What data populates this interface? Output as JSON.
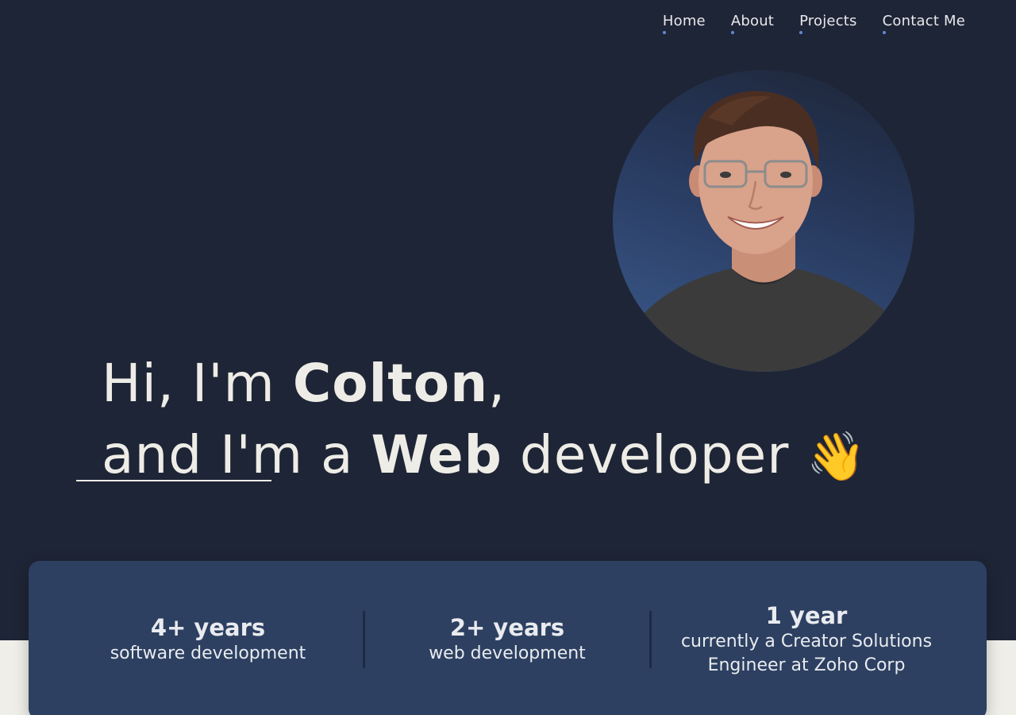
{
  "nav": {
    "items": [
      {
        "label": "Home"
      },
      {
        "label": "About"
      },
      {
        "label": "Projects"
      },
      {
        "label": "Contact Me"
      }
    ],
    "accent": "#5f8bd8"
  },
  "hero": {
    "line1_prefix": "Hi, I'm ",
    "line1_name": "Colton",
    "line1_suffix": ",",
    "line2_prefix": "and I'm a ",
    "line2_role": "Web",
    "line2_suffix": " developer ",
    "emoji": "👋"
  },
  "profile_photo": {
    "icon": "profile-photo"
  },
  "stats": [
    {
      "value": "4+ years",
      "label": "software development"
    },
    {
      "value": "2+ years",
      "label": "web development"
    },
    {
      "value": "1 year",
      "label": "currently a Creator Solutions Engineer at Zoho Corp"
    }
  ],
  "colors": {
    "background": "#1e2536",
    "card": "#2d4061",
    "light_band": "#efeee9",
    "text": "#eeece6"
  }
}
